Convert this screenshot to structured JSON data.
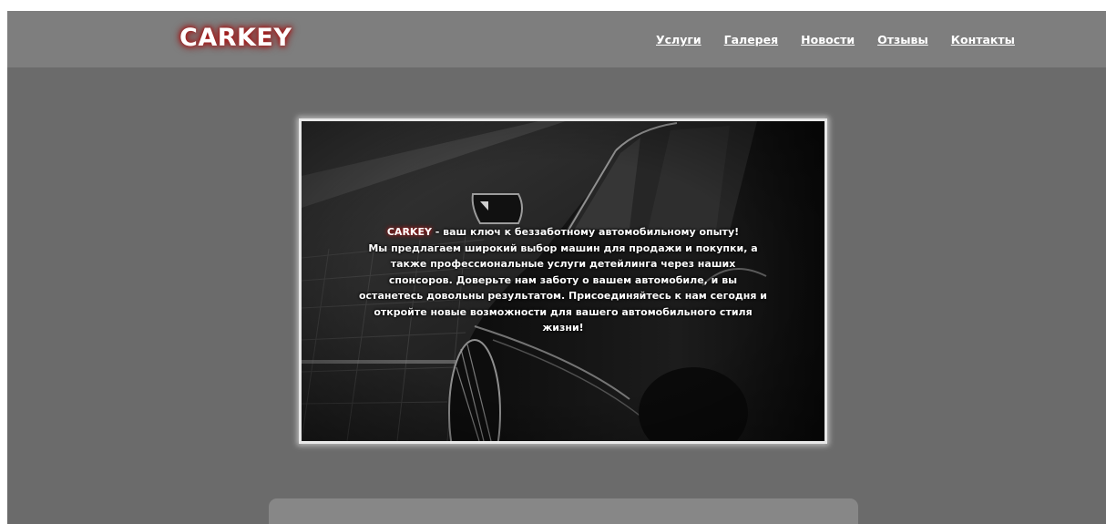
{
  "header": {
    "logo": "CARKEY",
    "nav": [
      {
        "label": "Услуги"
      },
      {
        "label": "Галерея"
      },
      {
        "label": "Новости"
      },
      {
        "label": "Отзывы"
      },
      {
        "label": "Контакты"
      }
    ]
  },
  "hero": {
    "brand": "CARKEY",
    "intro": " - ваш ключ к беззаботному автомобильному опыту!",
    "line2": "Мы предлагаем широкий выбор машин для продажи и покупки, а",
    "line3": "также профессиональные услуги детейлинга через наших",
    "line4": "спонсоров. Доверьте нам заботу о вашем автомобиле, и вы",
    "line5": "останетесь довольны результатом. Присоединяйтесь к нам сегодня и",
    "line6": "откройте новые возможности для вашего автомобильного стиля",
    "line7": "жизни!"
  },
  "colors": {
    "page_bg": "#6b6b6b",
    "header_bg": "#7e7e7e",
    "logo_glow": "#c02020",
    "panel_bg": "#878787"
  }
}
